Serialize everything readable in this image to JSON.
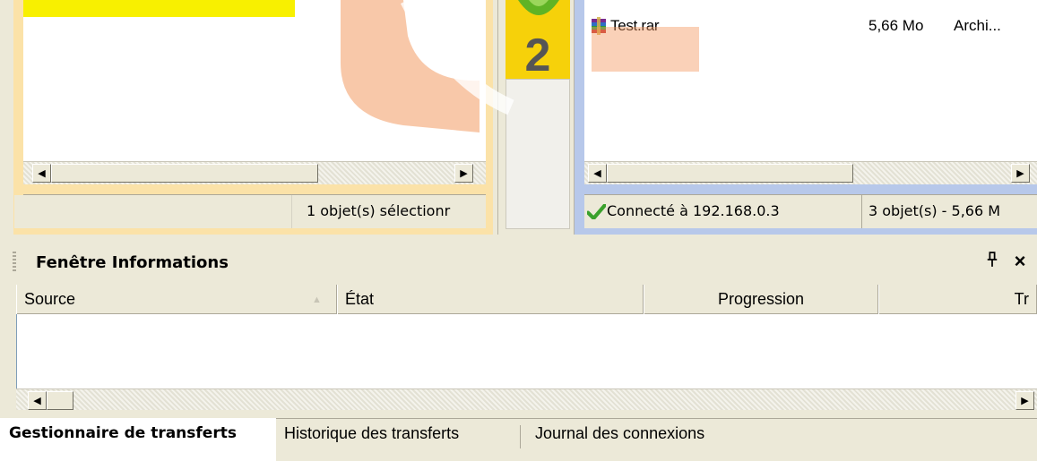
{
  "left_pane": {
    "status_text": "1 objet(s) sélectionr"
  },
  "middle_pane": {
    "badge_number": "2"
  },
  "right_pane": {
    "file": {
      "name": "Test.rar",
      "size": "5,66 Mo",
      "type": "Archi..."
    },
    "connection_status": "Connecté à 192.168.0.3",
    "summary": "3 objet(s) - 5,66 M"
  },
  "info_window": {
    "title": "Fenêtre Informations",
    "pin_glyph": "ᵖ",
    "close_glyph": "×",
    "columns": [
      "Source",
      "État",
      "Progression",
      "Tr"
    ]
  },
  "tabs": [
    "Gestionnaire de transferts",
    "Historique des transferts",
    "Journal des connexions"
  ],
  "colors": {
    "left_accent": "#fbe2a8",
    "right_accent": "#b7c8ea",
    "badge": "#f6d10a"
  }
}
